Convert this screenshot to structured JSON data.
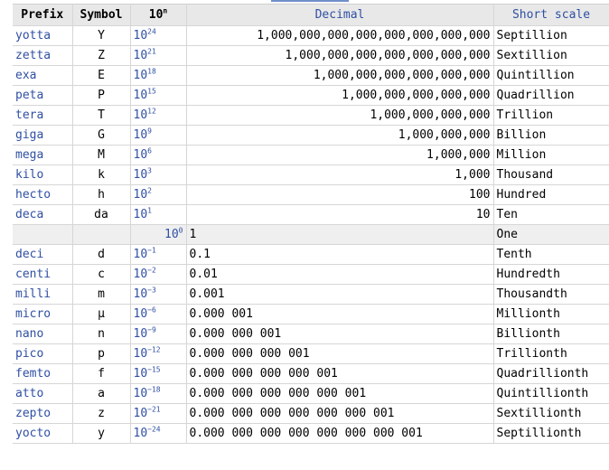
{
  "header": {
    "prefix": "Prefix",
    "symbol": "Symbol",
    "exp_base": "10",
    "exp_sup": "n",
    "decimal": "Decimal",
    "short": "Short scale"
  },
  "rows": [
    {
      "prefix": "yotta",
      "symbol": "Y",
      "base": "10",
      "exp": "24",
      "decimal": "1,000,000,000,000,000,000,000,000",
      "short": "Septillion",
      "align": "right"
    },
    {
      "prefix": "zetta",
      "symbol": "Z",
      "base": "10",
      "exp": "21",
      "decimal": "1,000,000,000,000,000,000,000",
      "short": "Sextillion",
      "align": "right"
    },
    {
      "prefix": "exa",
      "symbol": "E",
      "base": "10",
      "exp": "18",
      "decimal": "1,000,000,000,000,000,000",
      "short": "Quintillion",
      "align": "right"
    },
    {
      "prefix": "peta",
      "symbol": "P",
      "base": "10",
      "exp": "15",
      "decimal": "1,000,000,000,000,000",
      "short": "Quadrillion",
      "align": "right"
    },
    {
      "prefix": "tera",
      "symbol": "T",
      "base": "10",
      "exp": "12",
      "decimal": "1,000,000,000,000",
      "short": "Trillion",
      "align": "right"
    },
    {
      "prefix": "giga",
      "symbol": "G",
      "base": "10",
      "exp": "9",
      "decimal": "1,000,000,000",
      "short": "Billion",
      "align": "right"
    },
    {
      "prefix": "mega",
      "symbol": "M",
      "base": "10",
      "exp": "6",
      "decimal": "1,000,000",
      "short": "Million",
      "align": "right"
    },
    {
      "prefix": "kilo",
      "symbol": "k",
      "base": "10",
      "exp": "3",
      "decimal": "1,000",
      "short": "Thousand",
      "align": "right"
    },
    {
      "prefix": "hecto",
      "symbol": "h",
      "base": "10",
      "exp": "2",
      "decimal": "100",
      "short": "Hundred",
      "align": "right"
    },
    {
      "prefix": "deca",
      "symbol": "da",
      "base": "10",
      "exp": "1",
      "decimal": "10",
      "short": "Ten",
      "align": "right"
    },
    {
      "prefix": "",
      "symbol": "",
      "base": "10",
      "exp": "0",
      "decimal": "1",
      "short": "One",
      "align": "left",
      "unit": true
    },
    {
      "prefix": "deci",
      "symbol": "d",
      "base": "10",
      "exp": "−1",
      "decimal": "0.1",
      "short": "Tenth",
      "align": "left"
    },
    {
      "prefix": "centi",
      "symbol": "c",
      "base": "10",
      "exp": "−2",
      "decimal": "0.01",
      "short": "Hundredth",
      "align": "left"
    },
    {
      "prefix": "milli",
      "symbol": "m",
      "base": "10",
      "exp": "−3",
      "decimal": "0.001",
      "short": "Thousandth",
      "align": "left"
    },
    {
      "prefix": "micro",
      "symbol": "μ",
      "base": "10",
      "exp": "−6",
      "decimal": "0.000 001",
      "short": "Millionth",
      "align": "left"
    },
    {
      "prefix": "nano",
      "symbol": "n",
      "base": "10",
      "exp": "−9",
      "decimal": "0.000 000 001",
      "short": "Billionth",
      "align": "left"
    },
    {
      "prefix": "pico",
      "symbol": "p",
      "base": "10",
      "exp": "−12",
      "decimal": "0.000 000 000 001",
      "short": "Trillionth",
      "align": "left"
    },
    {
      "prefix": "femto",
      "symbol": "f",
      "base": "10",
      "exp": "−15",
      "decimal": "0.000 000 000 000 001",
      "short": "Quadrillionth",
      "align": "left"
    },
    {
      "prefix": "atto",
      "symbol": "a",
      "base": "10",
      "exp": "−18",
      "decimal": "0.000 000 000 000 000 001",
      "short": "Quintillionth",
      "align": "left"
    },
    {
      "prefix": "zepto",
      "symbol": "z",
      "base": "10",
      "exp": "−21",
      "decimal": "0.000 000 000 000 000 000 001",
      "short": "Sextillionth",
      "align": "left"
    },
    {
      "prefix": "yocto",
      "symbol": "y",
      "base": "10",
      "exp": "−24",
      "decimal": "0.000 000 000 000 000 000 000 001",
      "short": "Septillionth",
      "align": "left"
    }
  ],
  "colors": {
    "link": "#2f4fa3",
    "header_bg": "#e8e8e8",
    "unit_row_bg": "#efefef",
    "border": "#d6d6d6"
  }
}
